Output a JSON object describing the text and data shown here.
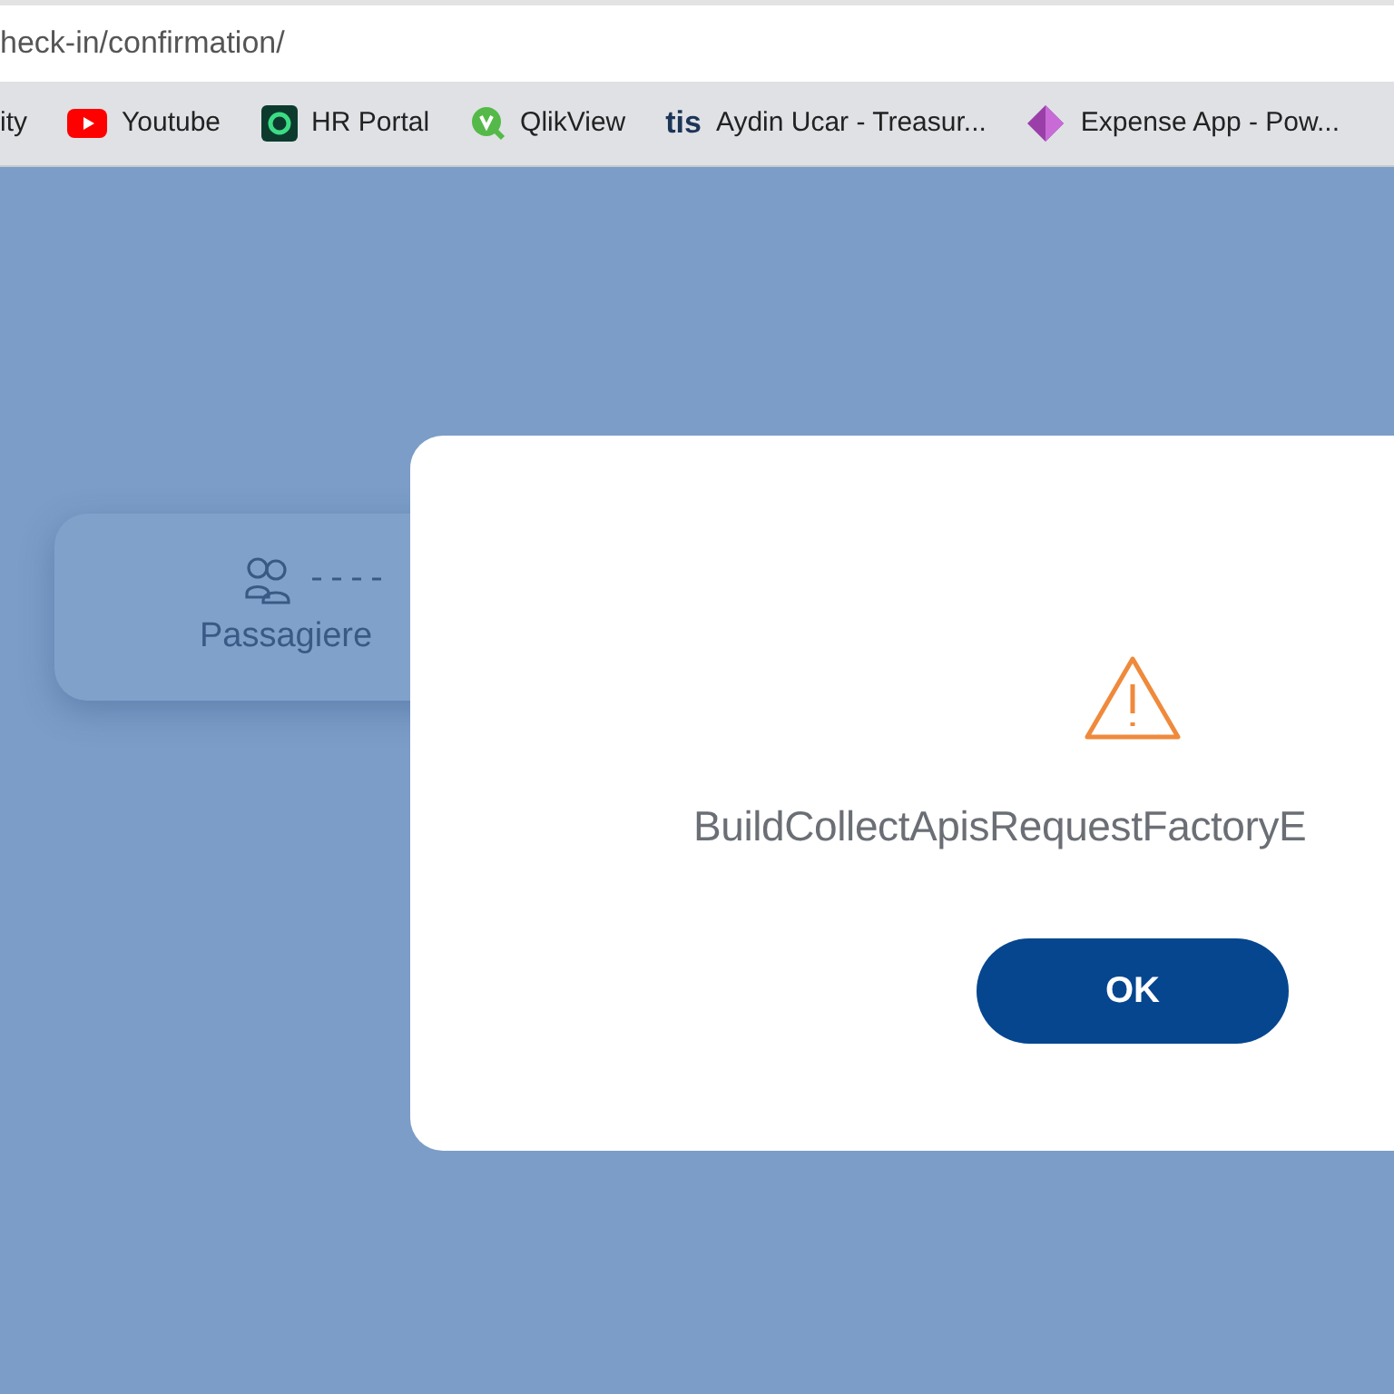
{
  "address_bar": {
    "url": "heck-in/confirmation/"
  },
  "bookmarks": [
    {
      "kind": "none",
      "label": "ity"
    },
    {
      "kind": "youtube",
      "label": "Youtube"
    },
    {
      "kind": "ring",
      "label": "HR Portal"
    },
    {
      "kind": "qlik",
      "label": "QlikView"
    },
    {
      "kind": "text",
      "logo_text": "tis",
      "label": "Aydin Ucar - Treasur..."
    },
    {
      "kind": "diamond",
      "label": "Expense App - Pow..."
    }
  ],
  "step": {
    "label": "Passagiere"
  },
  "dialog": {
    "message": "BuildCollectApisRequestFactoryE",
    "buttons": [
      "OK"
    ]
  }
}
